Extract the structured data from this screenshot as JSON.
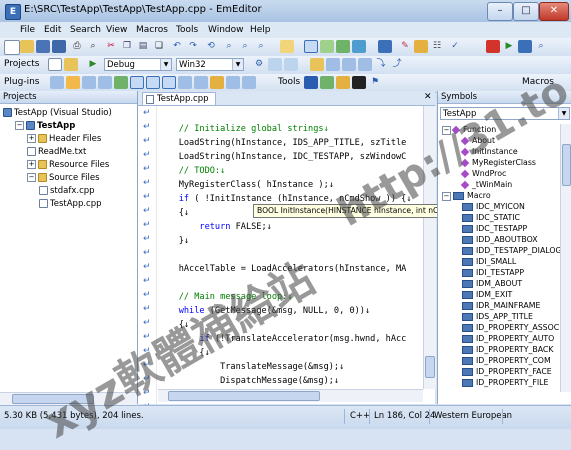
{
  "window": {
    "title": "E:\\SRC\\TestApp\\TestApp\\TestApp.cpp - EmEditor",
    "minimize": "–",
    "maximize": "□",
    "close": "✕"
  },
  "menu": [
    "File",
    "Edit",
    "Search",
    "View",
    "Macros",
    "Tools",
    "Window",
    "Help"
  ],
  "toolbar2": {
    "projects_label": "Projects",
    "config_value": "Debug",
    "platform_value": "Win32"
  },
  "toolbar3": {
    "plugins_label": "Plug-ins",
    "tools_label": "Tools",
    "macros_label": "Macros"
  },
  "projects_panel": {
    "header": "Projects",
    "items": [
      {
        "label": "TestApp (Visual Studio)",
        "indent": 0,
        "toggle": "",
        "type": "proj"
      },
      {
        "label": "TestApp",
        "indent": 1,
        "toggle": "-",
        "type": "proj",
        "bold": true
      },
      {
        "label": "Header Files",
        "indent": 2,
        "toggle": "+",
        "type": "folder"
      },
      {
        "label": "ReadMe.txt",
        "indent": 2,
        "toggle": "",
        "type": "file"
      },
      {
        "label": "Resource Files",
        "indent": 2,
        "toggle": "+",
        "type": "folder"
      },
      {
        "label": "Source Files",
        "indent": 2,
        "toggle": "-",
        "type": "folder"
      },
      {
        "label": "stdafx.cpp",
        "indent": 3,
        "toggle": "",
        "type": "file"
      },
      {
        "label": "TestApp.cpp",
        "indent": 3,
        "toggle": "",
        "type": "file"
      }
    ]
  },
  "editor": {
    "tab_label": "TestApp.cpp",
    "tooltip": "BOOL InitInstance(HINSTANCE hInstance, int nCmdShow)",
    "lines": [
      [],
      [
        [
          "cm",
          "    // Initialize global strings↓"
        ]
      ],
      [
        [
          "pl",
          "    LoadString(hInstance, IDS_APP_TITLE, szTitle"
        ]
      ],
      [
        [
          "pl",
          "    LoadString(hInstance, IDC_TESTAPP, szWindowC"
        ]
      ],
      [
        [
          "cm",
          "    // TODO:↓"
        ]
      ],
      [
        [
          "pl",
          "    MyRegisterClass( hInstance );↓"
        ]
      ],
      [
        [
          "kw",
          "    if"
        ],
        [
          "pl",
          " ( !InitInstance (hInstance, nCmdShow )) {↓"
        ]
      ],
      [
        [
          "pl",
          "    {↓"
        ]
      ],
      [
        [
          "kw",
          "        return"
        ],
        [
          "pl",
          " FALSE;↓"
        ]
      ],
      [
        [
          "pl",
          "    }↓"
        ]
      ],
      [],
      [
        [
          "pl",
          "    hAccelTable = LoadAccelerators(hInstance, MA"
        ]
      ],
      [],
      [
        [
          "cm",
          "    // Main message loop:↓"
        ]
      ],
      [
        [
          "kw",
          "    while"
        ],
        [
          "pl",
          " (GetMessage(&msg, NULL, 0, 0))↓"
        ]
      ],
      [
        [
          "pl",
          "    {↓"
        ]
      ],
      [
        [
          "kw",
          "        if"
        ],
        [
          "pl",
          " (!TranslateAccelerator(msg.hwnd, hAcc"
        ]
      ],
      [
        [
          "pl",
          "        {↓"
        ]
      ],
      [
        [
          "pl",
          "            TranslateMessage(&msg);↓"
        ]
      ],
      [
        [
          "pl",
          "            DispatchMessage(&msg);↓"
        ]
      ],
      [
        [
          "pl",
          "        }↓"
        ]
      ],
      [
        [
          "pl",
          "    }↓"
        ]
      ]
    ]
  },
  "symbols_panel": {
    "header": "Symbols",
    "file_combo": "TestApp",
    "groups": [
      {
        "label": "Function",
        "kind": "func",
        "items": [
          "About",
          "InitInstance",
          "MyRegisterClass",
          "WndProc",
          "_tWinMain"
        ]
      },
      {
        "label": "Macro",
        "kind": "macro",
        "items": [
          "IDC_MYICON",
          "IDC_STATIC",
          "IDC_TESTAPP",
          "IDD_ABOUTBOX",
          "IDD_TESTAPP_DIALOG",
          "IDI_SMALL",
          "IDI_TESTAPP",
          "IDM_ABOUT",
          "IDM_EXIT",
          "IDR_MAINFRAME",
          "IDS_APP_TITLE",
          "ID_PROPERTY_ASSOC",
          "ID_PROPERTY_AUTO",
          "ID_PROPERTY_BACK",
          "ID_PROPERTY_COM",
          "ID_PROPERTY_FACE",
          "ID_PROPERTY_FILE"
        ]
      }
    ]
  },
  "statusbar": {
    "size": "5.30 KB (5,431 bytes), 204 lines.",
    "language": "C++",
    "position": "Ln 186, Col 24",
    "encoding": "Western European"
  },
  "watermark": {
    "main": "xyz軟體補給站",
    "url": "http://31.to"
  }
}
